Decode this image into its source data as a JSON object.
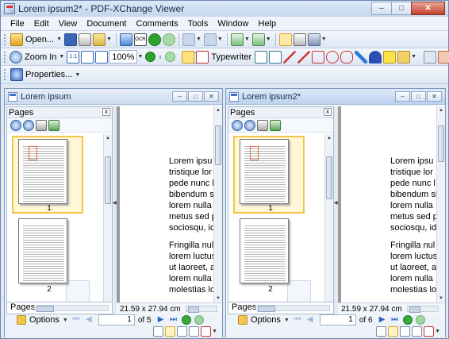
{
  "window": {
    "title": "Lorem ipsum2* - PDF-XChange Viewer"
  },
  "menu": [
    "File",
    "Edit",
    "View",
    "Document",
    "Comments",
    "Tools",
    "Window",
    "Help"
  ],
  "toolbar1": {
    "open_label": "Open..."
  },
  "toolbar2": {
    "zoom_label": "Zoom In",
    "zoom_value": "100%",
    "typewriter_label": "Typewriter"
  },
  "toolbar3": {
    "properties_label": "Properties..."
  },
  "documents": [
    {
      "title": "Lorem ipsum",
      "panel_title": "Pages",
      "panel_tab": "Pages",
      "thumbnails": [
        "1",
        "2"
      ],
      "page_size": "21.59 x 27.94 cm",
      "options_label": "Options",
      "page_number": "1",
      "page_count": "of 5",
      "paragraphs": [
        [
          "Lorem ipsu",
          "tristique lor",
          "pede nunc l",
          "bibendum si",
          "lorem nulla",
          "metus sed p",
          "sociosqu, id"
        ],
        [
          "Fringilla nul",
          "lorem luctus",
          "ut laoreet, a",
          "lorem nulla",
          "molestias lo"
        ]
      ]
    },
    {
      "title": "Lorem ipsum2*",
      "panel_title": "Pages",
      "panel_tab": "Pages",
      "thumbnails": [
        "1",
        "2"
      ],
      "page_size": "21.59 x 27.94 cm",
      "options_label": "Options",
      "page_number": "1",
      "page_count": "of 6",
      "paragraphs": [
        [
          "Lorem ipsu",
          "tristique lor",
          "pede nunc l",
          "bibendum si",
          "lorem nulla",
          "metus sed p",
          "sociosqu, id"
        ],
        [
          "Fringilla nul",
          "lorem luctus",
          "ut laoreet, a",
          "lorem nulla",
          "molestias lo"
        ]
      ]
    }
  ],
  "colors": {
    "selection": "#f2c54a",
    "accent": "#2b62c9",
    "close": "#c2402a"
  }
}
